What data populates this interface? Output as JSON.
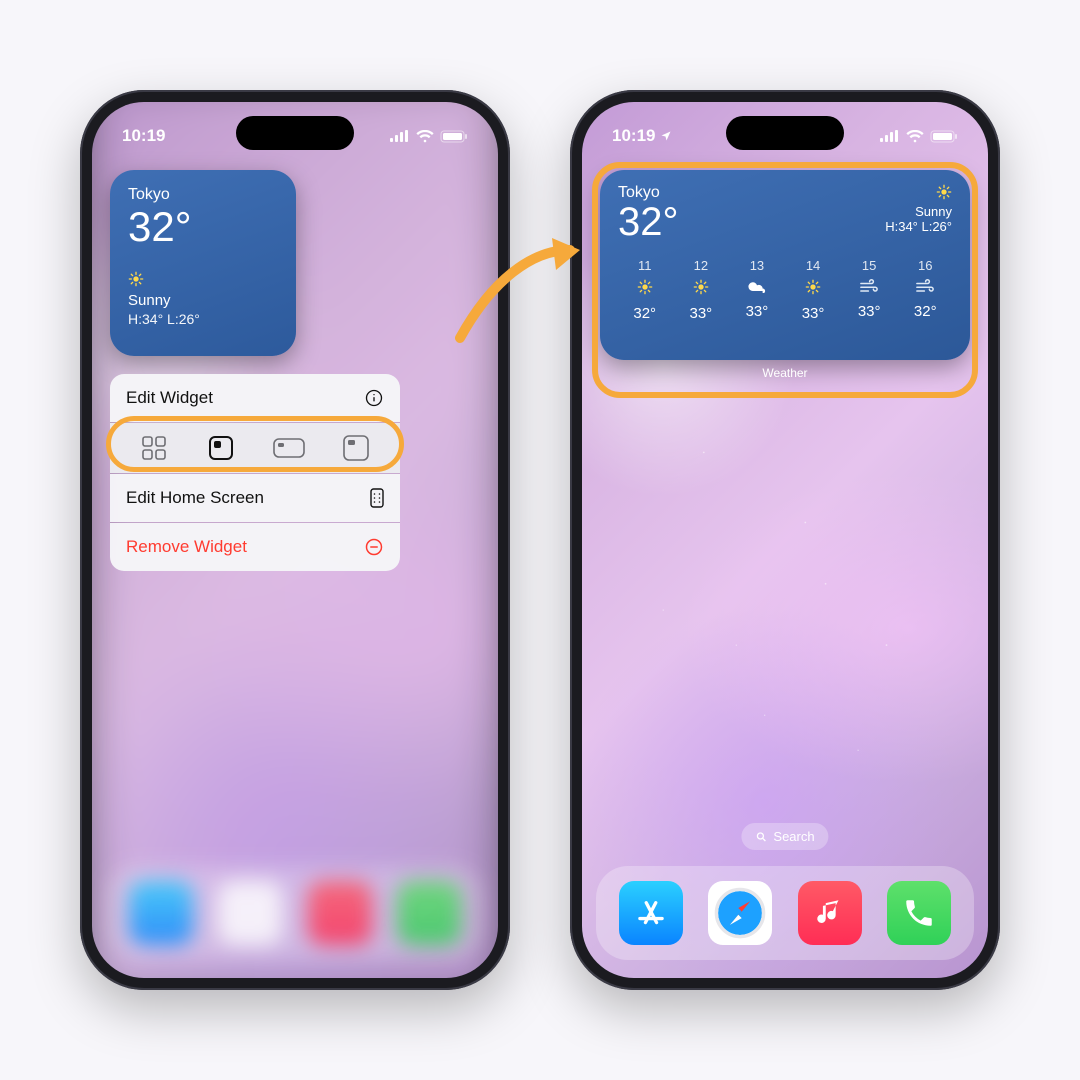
{
  "colors": {
    "highlight": "#f6a93b",
    "danger": "#ff3b30",
    "widget_bg1": "#3f6fb4",
    "widget_bg2": "#2c5898"
  },
  "statusbar": {
    "time": "10:19",
    "show_location_arrow_right": true
  },
  "weather": {
    "city": "Tokyo",
    "temp": "32°",
    "condition": "Sunny",
    "hi": "34°",
    "lo": "26°"
  },
  "forecast": {
    "label": "Weather",
    "hours": [
      {
        "h": "11",
        "icon": "sun",
        "t": "32°"
      },
      {
        "h": "12",
        "icon": "sun",
        "t": "33°"
      },
      {
        "h": "13",
        "icon": "cloud",
        "t": "33°"
      },
      {
        "h": "14",
        "icon": "sun",
        "t": "33°"
      },
      {
        "h": "15",
        "icon": "wind",
        "t": "33°"
      },
      {
        "h": "16",
        "icon": "wind",
        "t": "32°"
      }
    ]
  },
  "context_menu": {
    "edit_widget": "Edit Widget",
    "edit_home": "Edit Home Screen",
    "remove": "Remove Widget",
    "sizes": [
      "apps",
      "small",
      "medium",
      "large"
    ],
    "selected_size": "small"
  },
  "search": {
    "label": "Search"
  },
  "dock": {
    "apps": [
      "app-store",
      "safari",
      "music",
      "phone"
    ]
  },
  "hilo_text": "H:34° L:26°"
}
